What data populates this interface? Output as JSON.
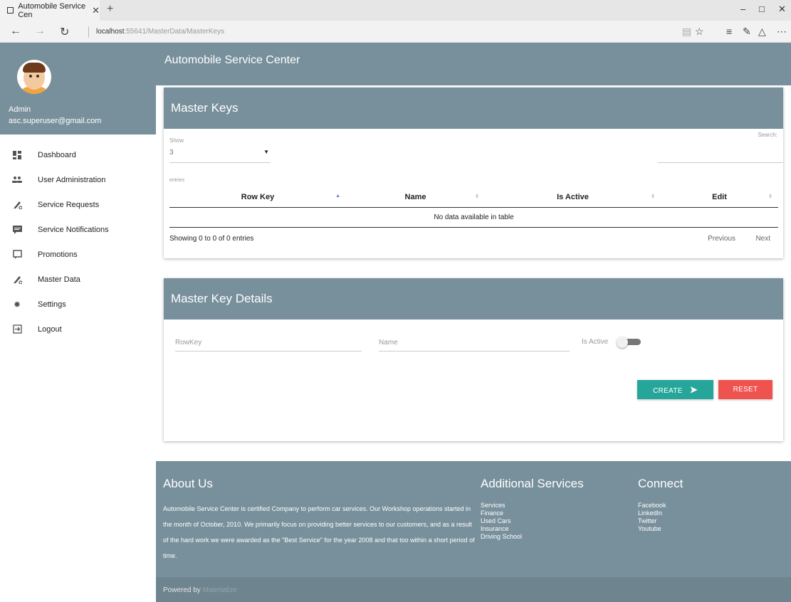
{
  "browser": {
    "tab_title": "Automobile Service Cen",
    "tab_close": "✕",
    "new_tab": "+",
    "url_host": "localhost",
    "url_path": ":55641/MasterData/MasterKeys"
  },
  "sidebar": {
    "user_name": "Admin",
    "user_email": "asc.superuser@gmail.com",
    "items": [
      {
        "label": "Dashboard",
        "icon": "dashboard-icon"
      },
      {
        "label": "User Administration",
        "icon": "users-icon"
      },
      {
        "label": "Service Requests",
        "icon": "service-icon"
      },
      {
        "label": "Service Notifications",
        "icon": "comment-icon"
      },
      {
        "label": "Promotions",
        "icon": "message-icon"
      },
      {
        "label": "Master Data",
        "icon": "service-icon"
      },
      {
        "label": "Settings",
        "icon": "gear-icon"
      },
      {
        "label": "Logout",
        "icon": "logout-icon"
      }
    ]
  },
  "header": {
    "title": "Automobile Service Center"
  },
  "master_keys": {
    "title": "Master Keys",
    "show_label": "Show",
    "page_length": "3",
    "search_label": "Search:",
    "entries_label": "entries",
    "columns": [
      "Row Key",
      "Name",
      "Is Active",
      "Edit"
    ],
    "empty_message": "No data available in table",
    "info": "Showing 0 to 0 of 0 entries",
    "previous": "Previous",
    "next": "Next"
  },
  "details": {
    "title": "Master Key Details",
    "rowkey_placeholder": "RowKey",
    "name_placeholder": "Name",
    "is_active_label": "Is Active",
    "create_label": "CREATE",
    "reset_label": "RESET"
  },
  "footer": {
    "about_title": "About Us",
    "about_text": "Automobile Service Center is certified Company to perform car services. Our Workshop operations started in the month of October, 2010. We primarily focus on providing better services to our customers, and as a result of the hard work we were awarded as the \"Best Service\" for the year 2008 and that too within a short period of time.",
    "services_title": "Additional Services",
    "services": [
      "Services",
      "Finance",
      "Used Cars",
      "Insurance",
      "Driving School"
    ],
    "connect_title": "Connect",
    "connect": [
      "Facebook",
      "LinkedIn",
      "Twitter",
      "Youtube"
    ],
    "powered_by": "Powered by",
    "powered_link": "Materialize"
  },
  "colors": {
    "primary": "#78909c",
    "create": "#26a69a",
    "reset": "#ef5350"
  }
}
